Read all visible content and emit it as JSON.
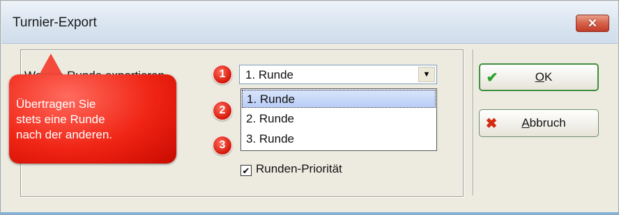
{
  "window": {
    "title": "Turnier-Export",
    "close_symbol": "✕"
  },
  "form": {
    "round_label": "Welche Runde exportieren",
    "combo_value": "1. Runde",
    "combo_arrow": "▼",
    "options": [
      "1. Runde",
      "2. Runde",
      "3. Runde"
    ],
    "selected_option": "1. Runde",
    "priority_checkbox": {
      "label": "Runden-Priorität",
      "checked": true,
      "mark": "✔"
    }
  },
  "buttons": {
    "ok": {
      "label_underline": "O",
      "label_rest": "K",
      "icon": "check-icon"
    },
    "cancel": {
      "label_underline": "A",
      "label_rest": "bbruch",
      "icon": "x-icon"
    }
  },
  "annotations": {
    "badges": [
      "1",
      "2",
      "3"
    ],
    "callout_lines": [
      "Übertragen Sie",
      "stets eine Runde",
      "nach der anderen."
    ]
  },
  "colors": {
    "ok_icon": "#2aa12a",
    "cancel_icon": "#d42a10",
    "badge": "#e21b0c",
    "callout": "#f02414"
  }
}
